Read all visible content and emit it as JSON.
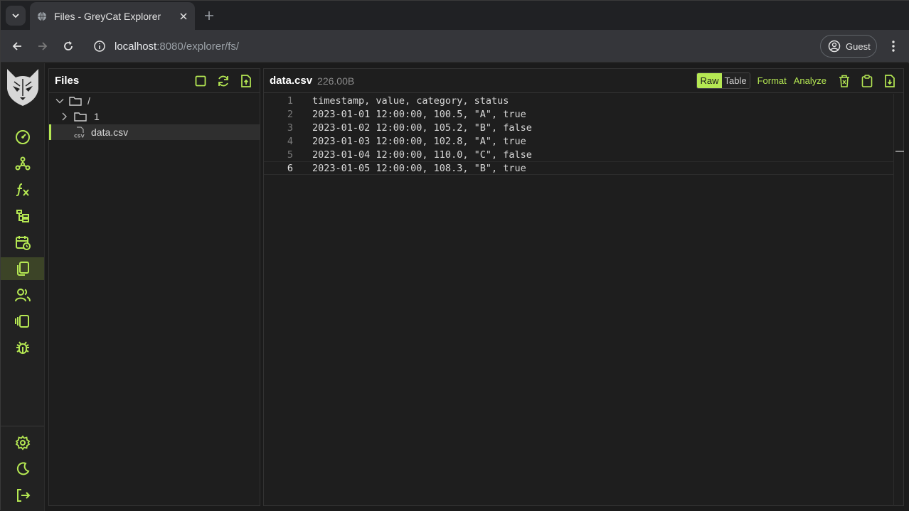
{
  "browser": {
    "tab_title": "Files - GreyCat Explorer",
    "url_host": "localhost",
    "url_rest": ":8080/explorer/fs/",
    "profile_label": "Guest"
  },
  "rail": {
    "items": [
      "dashboard-icon",
      "graph-icon",
      "function-icon",
      "tree-icon",
      "calendar-icon",
      "files-icon",
      "users-icon",
      "panels-icon",
      "bug-icon"
    ],
    "bottom": [
      "settings-icon",
      "moon-icon",
      "logout-icon"
    ],
    "active": "files-icon"
  },
  "files": {
    "title": "Files",
    "tree": [
      {
        "name": "/",
        "type": "folder",
        "expanded": true
      },
      {
        "name": "1",
        "type": "folder",
        "expanded": false
      },
      {
        "name": "data.csv",
        "type": "csv",
        "selected": true
      }
    ]
  },
  "viewer": {
    "file_name": "data.csv",
    "file_size": "226.00B",
    "mode_raw": "Raw",
    "mode_table": "Table",
    "format_label": "Format",
    "analyze_label": "Analyze",
    "lines": [
      "timestamp, value, category, status",
      "2023-01-01 12:00:00, 100.5, \"A\", true",
      "2023-01-02 12:00:00, 105.2, \"B\", false",
      "2023-01-03 12:00:00, 102.8, \"A\", true",
      "2023-01-04 12:00:00, 110.0, \"C\", false",
      "2023-01-05 12:00:00, 108.3, \"B\", true"
    ],
    "line_numbers": [
      "1",
      "2",
      "3",
      "4",
      "5",
      "6"
    ]
  },
  "colors": {
    "accent": "#b5e853",
    "background": "#1b1b1b"
  }
}
